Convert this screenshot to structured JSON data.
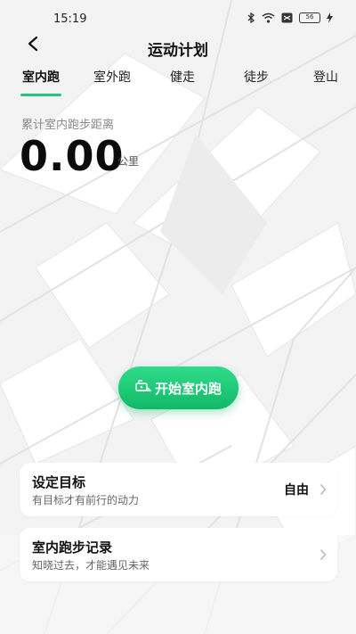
{
  "status_bar": {
    "time": "15:19",
    "battery": "56",
    "icons": [
      "bluetooth-icon",
      "wifi-icon",
      "sim-icon",
      "battery-icon",
      "charging-icon"
    ]
  },
  "header": {
    "title": "运动计划",
    "back_icon": "back-arrow-icon"
  },
  "tabs": [
    {
      "label": "室内跑",
      "active": true
    },
    {
      "label": "室外跑",
      "active": false
    },
    {
      "label": "健走",
      "active": false
    },
    {
      "label": "徒步",
      "active": false
    },
    {
      "label": "登山",
      "active": false
    }
  ],
  "distance": {
    "label": "累计室内跑步距离",
    "value": "0.00",
    "unit": "公里"
  },
  "start_button": {
    "label": "开始室内跑",
    "icon": "treadmill-icon"
  },
  "cards": [
    {
      "title": "设定目标",
      "subtitle": "有目标才有前行的动力",
      "value": "自由"
    },
    {
      "title": "室内跑步记录",
      "subtitle": "知晓过去，才能遇见未来",
      "value": ""
    }
  ],
  "colors": {
    "accent": "#1ec77a",
    "button_top": "#2fdc8a",
    "button_bottom": "#12b868",
    "background": "#f4f4f4"
  }
}
